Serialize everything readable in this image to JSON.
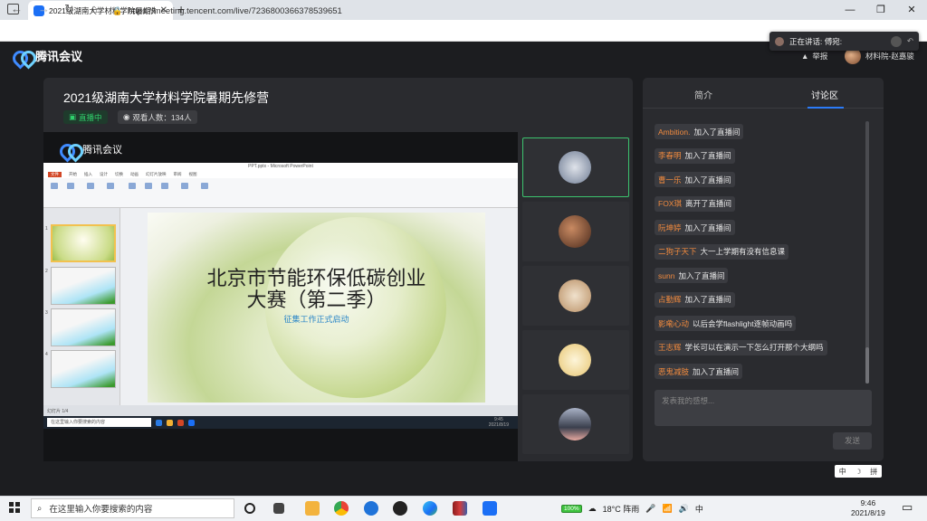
{
  "browser": {
    "tab_title": "2021级湖南大学材料学院暑期先",
    "url": "https://meeting.tencent.com/live/7236800366378539651"
  },
  "speaking": {
    "label": "正在讲话: 傅宛:"
  },
  "app": {
    "logo_text": "腾讯会议",
    "report": "举报",
    "user_name": "材料院-赵嘉骏"
  },
  "live": {
    "title": "2021级湖南大学材料学院暑期先修营",
    "status": "直播中",
    "viewers": "观看人数：134人",
    "stage_logo": "腾讯会议"
  },
  "ppt": {
    "window_title": "PPT.pptx - Microsoft PowerPoint",
    "menu": [
      "文件",
      "开始",
      "插入",
      "设计",
      "切换",
      "动画",
      "幻灯片放映",
      "审阅",
      "视图"
    ],
    "slide_title_1": "北京市节能环保低碳创业",
    "slide_title_2": "大赛（第二季）",
    "slide_subtitle": "征集工作正式启动",
    "status_left": "幻灯片 1/4",
    "inner_search": "在这里输入你要搜索的内容",
    "inner_clock": "9:45",
    "inner_date": "2021/8/19",
    "thumb_nums": [
      "1",
      "2",
      "3",
      "4"
    ]
  },
  "tabs": {
    "intro": "简介",
    "discussion": "讨论区"
  },
  "chat": [
    {
      "name": "Ambition.",
      "text": "加入了直播间"
    },
    {
      "name": "李春明",
      "text": "加入了直播间"
    },
    {
      "name": "曹一乐",
      "text": "加入了直播间"
    },
    {
      "name": "FOX琪",
      "text": "离开了直播间"
    },
    {
      "name": "阮坤婷",
      "text": "加入了直播间"
    },
    {
      "name": "二狗子天下",
      "text": "大一上学期有没有信息课"
    },
    {
      "name": "sunn",
      "text": "加入了直播间"
    },
    {
      "name": "占勤辉",
      "text": "加入了直播间"
    },
    {
      "name": "影嘞心动",
      "text": "以后会学flashlight逐帧动画吗"
    },
    {
      "name": "王志辉",
      "text": "学长可以在演示一下怎么打开那个大纲吗"
    },
    {
      "name": "恶鬼减肢",
      "text": "加入了直播间"
    }
  ],
  "chat_input": {
    "placeholder": "发表我的感想..."
  },
  "send": "发送",
  "ime": [
    "中",
    "☽",
    "拼"
  ],
  "taskbar": {
    "search_placeholder": "在这里输入你要搜索的内容",
    "battery": "100%",
    "weather": "18°C  阵雨",
    "time": "9:46",
    "date": "2021/8/19"
  },
  "colors": {
    "accent": "#2b7bf8",
    "live_green": "#2fcf6b",
    "name_orange": "#f08a3e"
  }
}
